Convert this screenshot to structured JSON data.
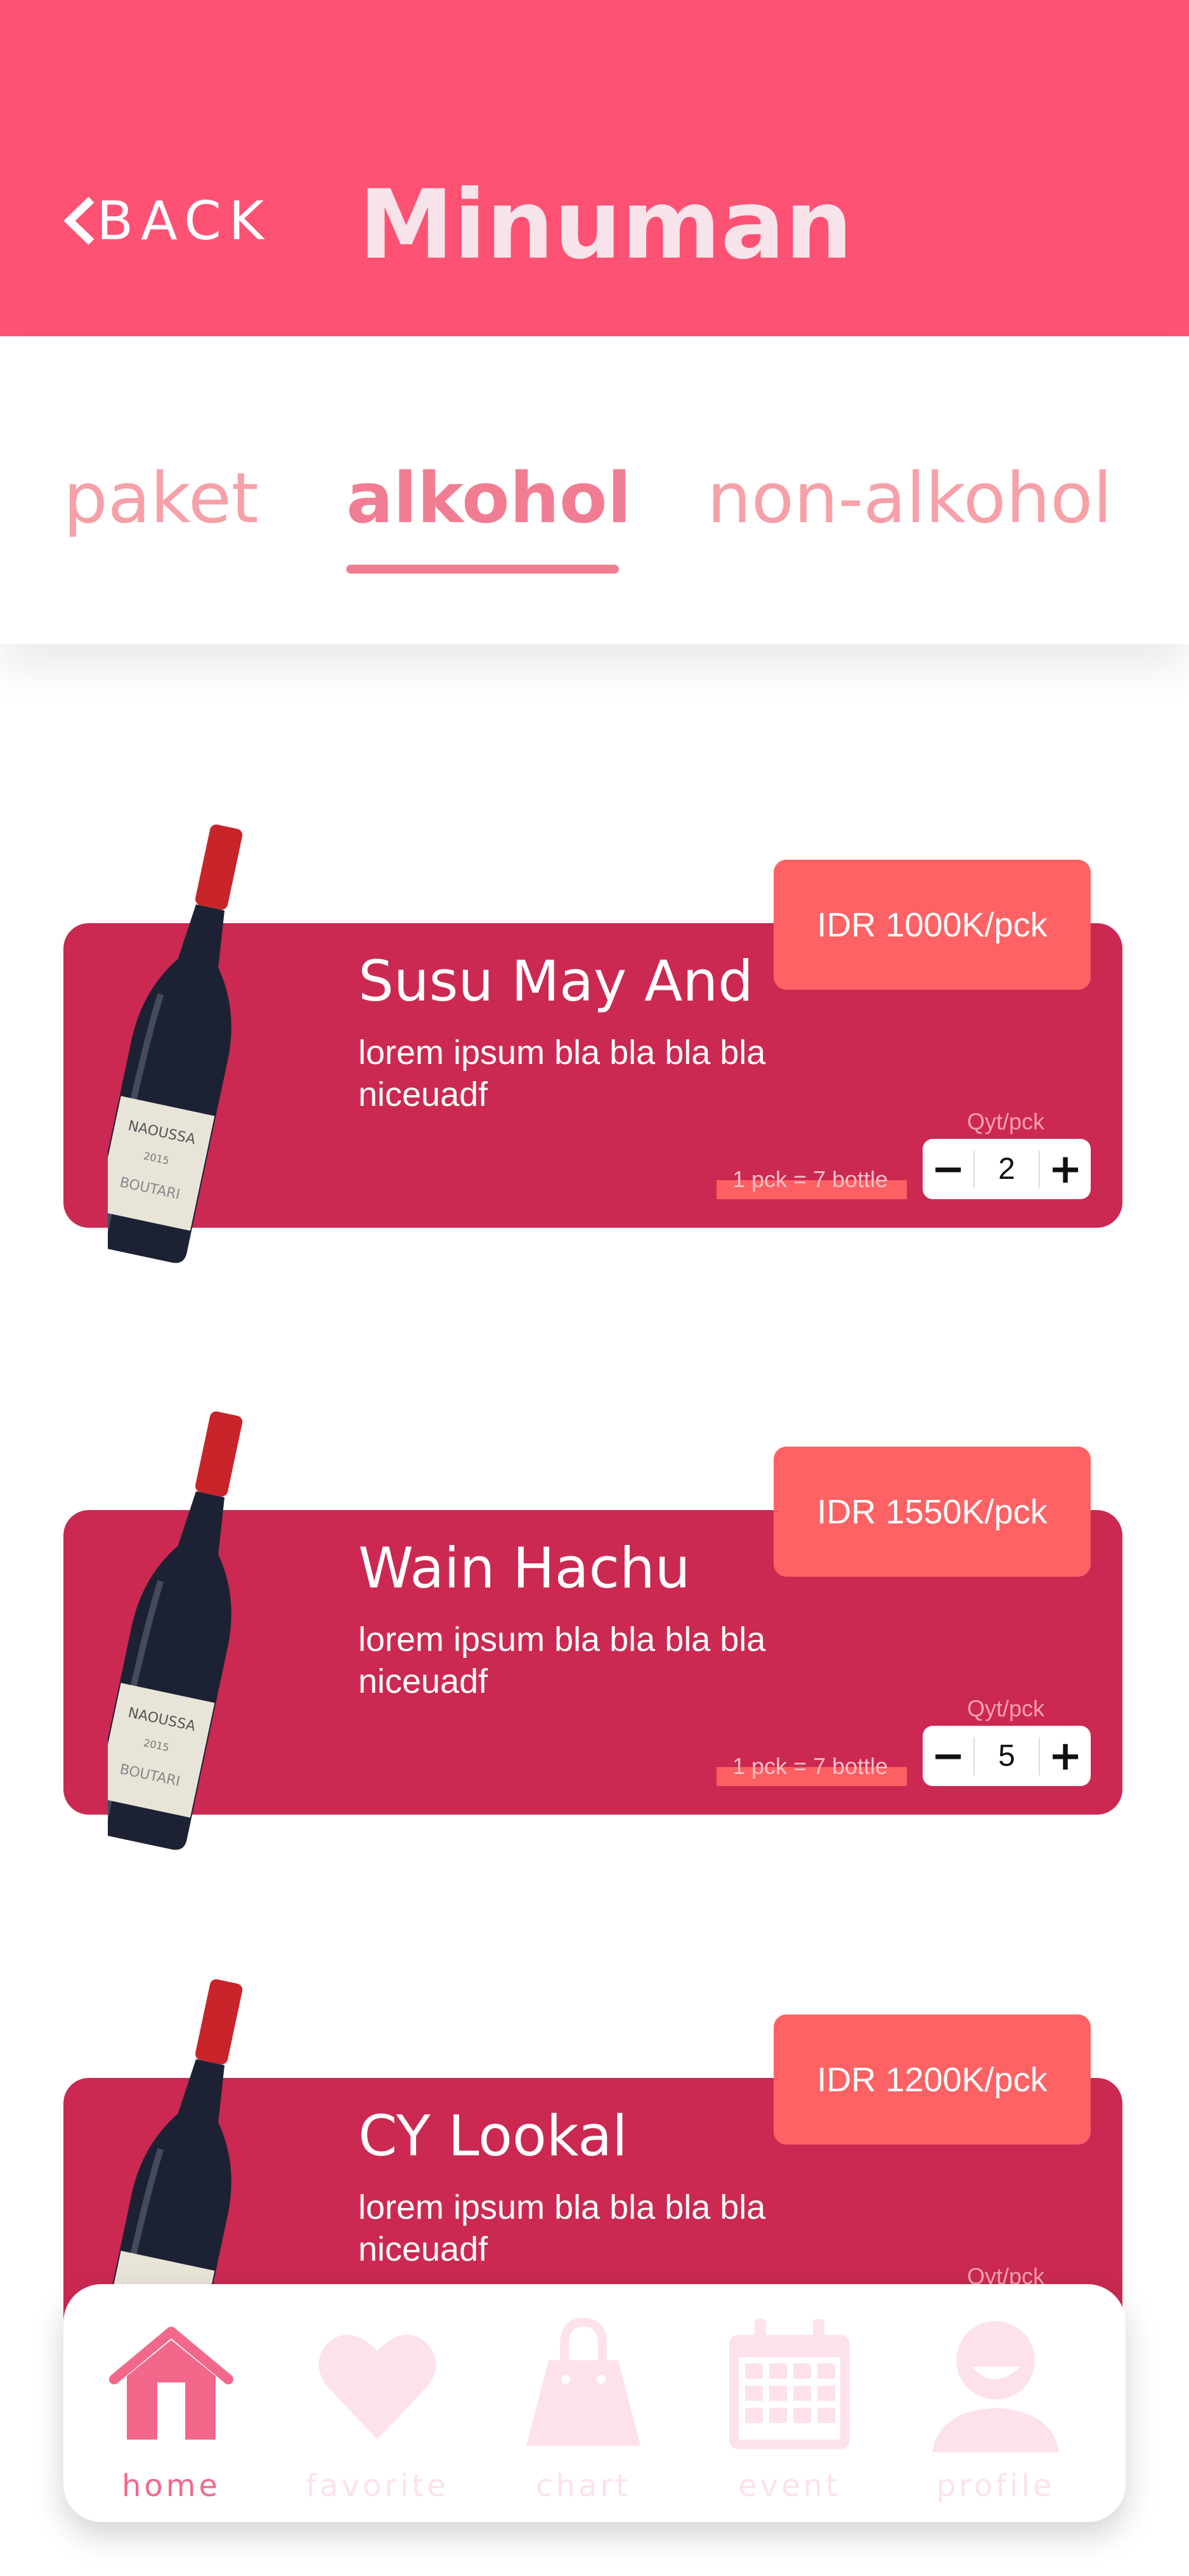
{
  "header": {
    "back_label": "BACK",
    "title": "Minuman"
  },
  "tabs": [
    {
      "label": "paket",
      "active": false
    },
    {
      "label": "alkohol",
      "active": true
    },
    {
      "label": "non-alkohol",
      "active": false
    }
  ],
  "products": [
    {
      "name": "Susu May And",
      "description": "lorem ipsum bla  bla bla bla niceuadf",
      "price": "IDR 1000K/pck",
      "pack_info": "1 pck = 7 bottle",
      "qty_label": "Qyt/pck",
      "quantity": "2"
    },
    {
      "name": "Wain Hachu",
      "description": "lorem ipsum bla  bla bla bla niceuadf",
      "price": "IDR 1550K/pck",
      "pack_info": "1 pck = 7 bottle",
      "qty_label": "Qyt/pck",
      "quantity": "5"
    },
    {
      "name": "CY Lookal",
      "description": "lorem ipsum bla  bla bla bla niceuadf",
      "price": "IDR 1200K/pck",
      "qty_label": "Qyt/pck"
    }
  ],
  "stepper": {
    "minus": "−",
    "plus": "+"
  },
  "bottle_label": {
    "brand": "NAOUSSA",
    "year": "2015",
    "maker": "BOUTARI"
  },
  "nav": [
    {
      "label": "home",
      "icon": "home-icon",
      "active": true
    },
    {
      "label": "favorite",
      "icon": "heart-icon",
      "active": false
    },
    {
      "label": "chart",
      "icon": "shopping-bag-icon",
      "active": false
    },
    {
      "label": "event",
      "icon": "calendar-icon",
      "active": false
    },
    {
      "label": "profile",
      "icon": "user-icon",
      "active": false
    }
  ],
  "colors": {
    "header": "#fe5275",
    "card": "#cb2951",
    "price_tag": "#fe6264",
    "tab_active": "#f27d92",
    "tab_inactive": "#f7a0a8",
    "nav_active": "#f2688a",
    "nav_inactive": "#fde2ea"
  }
}
